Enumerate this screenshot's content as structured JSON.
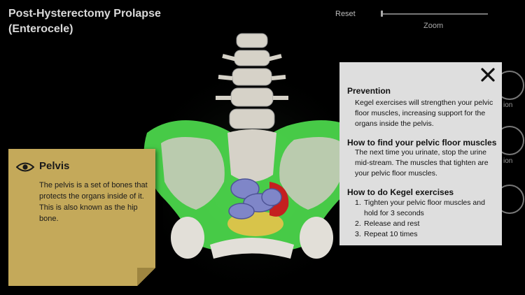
{
  "header": {
    "title": "Post-Hysterectomy Prolapse (Enterocele)",
    "reset_label": "Reset",
    "zoom_label": "Zoom",
    "zoom_level": 0
  },
  "edge": {
    "label_1": "ion",
    "label_2": "ion"
  },
  "note": {
    "icon": "eye-icon",
    "heading": "Pelvis",
    "body": "The pelvis is a set of bones that protects the organs inside of it. This is also known as the hip bone.",
    "background": "#c4a95a"
  },
  "panel": {
    "close_icon": "close-icon",
    "prevention_heading": "Prevention",
    "prevention_body": "Kegel exercises will strengthen your pelvic floor muscles, increasing support for the organs inside the pelvis.",
    "find_heading": "How to find your pelvic floor muscles",
    "find_body": "The next time you urinate, stop the urine mid-stream. The muscles that tighten are your pelvic floor muscles.",
    "howto_heading": "How to do Kegel exercises",
    "steps": [
      {
        "num": "1.",
        "text": "Tighten your pelvic floor muscles and hold for 3 seconds"
      },
      {
        "num": "2.",
        "text": "Release and rest"
      },
      {
        "num": "3.",
        "text": "Repeat 10 times"
      }
    ]
  },
  "colors": {
    "pelvic_floor": "#4fe04f",
    "bone": "#d6d2c8",
    "intestine": "#7f86c8",
    "uterus": "#c42020",
    "bladder": "#d8c44a"
  }
}
